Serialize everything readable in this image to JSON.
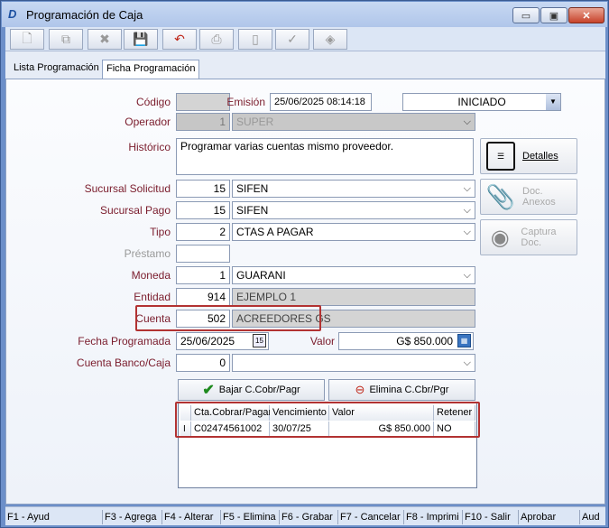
{
  "window": {
    "title": "Programación de Caja",
    "app_icon": "D"
  },
  "window_buttons": {
    "minimize": "▭",
    "maximize": "▣",
    "close": "✕"
  },
  "toolbar": {
    "buttons": [
      {
        "name": "new-icon",
        "glyph": "🗋",
        "enabled": false
      },
      {
        "name": "copy-icon",
        "glyph": "⧉",
        "enabled": false
      },
      {
        "name": "delete-icon",
        "glyph": "✖",
        "enabled": false
      },
      {
        "name": "save-icon",
        "glyph": "💾",
        "enabled": true
      },
      {
        "name": "undo-icon",
        "glyph": "↶",
        "enabled": true
      },
      {
        "name": "print-icon",
        "glyph": "⎙",
        "enabled": false
      },
      {
        "name": "document-icon",
        "glyph": "▯",
        "enabled": false
      },
      {
        "name": "check-icon",
        "glyph": "✓",
        "enabled": false
      },
      {
        "name": "eraser-icon",
        "glyph": "◈",
        "enabled": false
      }
    ]
  },
  "tabs": {
    "lista": "Lista Programación",
    "ficha": "Ficha Programación"
  },
  "form": {
    "codigo_label": "Código",
    "codigo_value": "",
    "emision_label": "Emisión",
    "emision_value": "25/06/2025 08:14:18",
    "estado_value": "INICIADO",
    "operador_label": "Operador",
    "operador_code": "1",
    "operador_name": "SUPER",
    "historico_label": "Histórico",
    "historico_value": "Programar varias cuentas mismo proveedor.",
    "sucursal_solicitud_label": "Sucursal Solicitud",
    "sucursal_solicitud_code": "15",
    "sucursal_solicitud_name": "SIFEN",
    "sucursal_pago_label": "Sucursal Pago",
    "sucursal_pago_code": "15",
    "sucursal_pago_name": "SIFEN",
    "tipo_label": "Tipo",
    "tipo_code": "2",
    "tipo_name": "CTAS A PAGAR",
    "prestamo_label": "Préstamo",
    "prestamo_value": "",
    "moneda_label": "Moneda",
    "moneda_code": "1",
    "moneda_name": "GUARANI",
    "entidad_label": "Entidad",
    "entidad_code": "914",
    "entidad_name": "EJEMPLO 1",
    "cuenta_label": "Cuenta",
    "cuenta_code": "502",
    "cuenta_name": "ACREEDORES GS",
    "fecha_programada_label": "Fecha Programada",
    "fecha_programada_value": "25/06/2025",
    "valor_label": "Valor",
    "valor_value": "G$ 850.000",
    "cuenta_banco_label": "Cuenta Banco/Caja",
    "cuenta_banco_code": "0",
    "cuenta_banco_name": ""
  },
  "side_buttons": {
    "detalles": "Detalles",
    "doc_anexos": "Doc. Anexos",
    "captura_doc": "Captura Doc."
  },
  "actions": {
    "bajar": "Bajar C.Cobr/Pagr",
    "elimina": "Elimina C.Cbr/Pgr"
  },
  "grid": {
    "columns": [
      "Cta.Cobrar/Pagar",
      "Vencimiento",
      "Valor",
      "Retener"
    ],
    "rows": [
      {
        "marker": "I",
        "cuenta": "C02474561002",
        "vencimiento": "30/07/25",
        "valor": "G$ 850.000",
        "retener": "NO"
      }
    ]
  },
  "status_bar": [
    "F1 - Ayud",
    "F3 - Agrega",
    "F4 - Alterar",
    "F5 - Elimina",
    "F6 - Grabar",
    "F7 - Cancelar",
    "F8 - Imprimi",
    "F10 - Salir",
    "Aprobar",
    "Aud"
  ],
  "colors": {
    "label": "#7a1c2c",
    "highlight": "#b23232",
    "accent": "#6c8fc9"
  }
}
